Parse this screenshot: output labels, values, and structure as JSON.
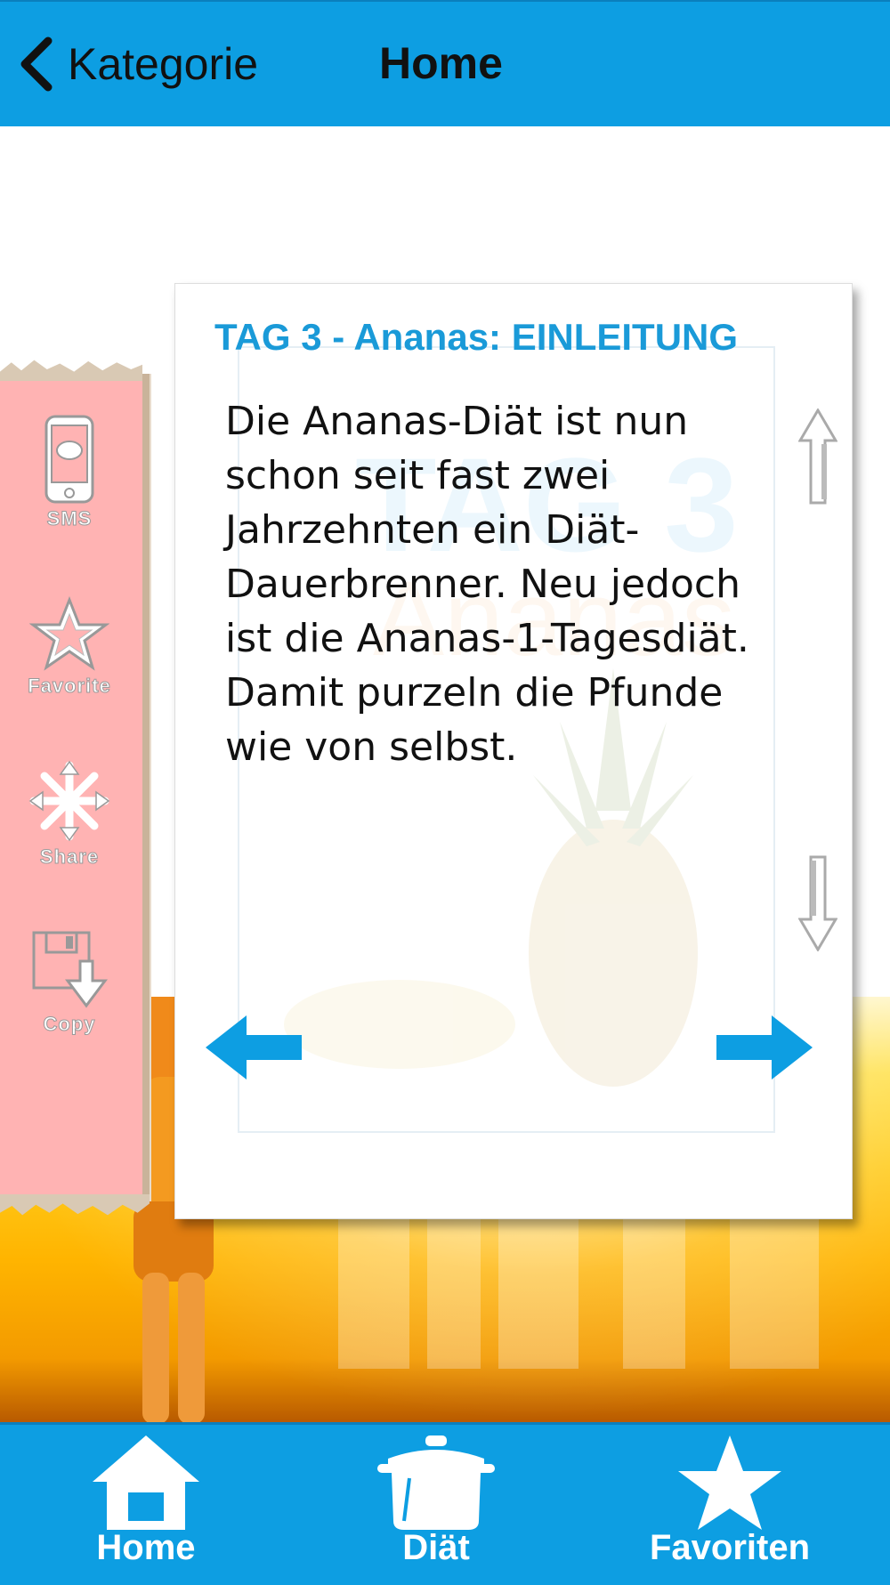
{
  "nav": {
    "back_label": "Kategorie",
    "title": "Home"
  },
  "card": {
    "title": "TAG 3 - Ananas: EINLEITUNG",
    "body": "Die Ananas-Diät ist nun schon seit fast zwei Jahrzehnten ein Diät-Dauerbrenner. Neu jedoch ist die Ananas-1-Tagesdiät. Damit purzeln die Pfunde wie von selbst.",
    "watermark_tag": "TAG 3",
    "watermark_word": "Ananas"
  },
  "side_actions": [
    {
      "label": "SMS",
      "icon": "phone-sms-icon"
    },
    {
      "label": "Favorite",
      "icon": "star-icon"
    },
    {
      "label": "Share",
      "icon": "share-snowflake-icon"
    },
    {
      "label": "Copy",
      "icon": "copy-floppy-icon"
    }
  ],
  "tabs": [
    {
      "label": "Home",
      "icon": "home-icon"
    },
    {
      "label": "Diät",
      "icon": "pot-icon"
    },
    {
      "label": "Favoriten",
      "icon": "star-icon"
    }
  ],
  "colors": {
    "accent": "#0d9ee2",
    "title_blue": "#1a9ad8",
    "side_panel": "#ffb3b3"
  }
}
